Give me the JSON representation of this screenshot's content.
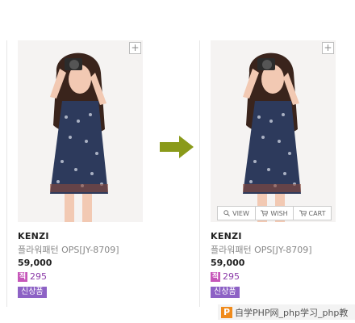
{
  "cards": [
    {
      "brand": "KENZI",
      "name": "플라워패턴 OPS[JY-8709]",
      "price": "59,000",
      "points_icon": "적",
      "points": "295",
      "badge": "신상품"
    },
    {
      "brand": "KENZI",
      "name": "플라워패턴 OPS[JY-8709]",
      "price": "59,000",
      "points_icon": "적",
      "points": "295",
      "badge": "신상품",
      "hover_actions": [
        "VIEW",
        "WISH",
        "CART"
      ]
    }
  ],
  "watermark": {
    "logo": "P",
    "text": "自学PHP网_php学习_php教"
  },
  "colors": {
    "arrow": "#8a9a1a",
    "badge": "#8d62c5",
    "points_icon": "#c657b9"
  }
}
